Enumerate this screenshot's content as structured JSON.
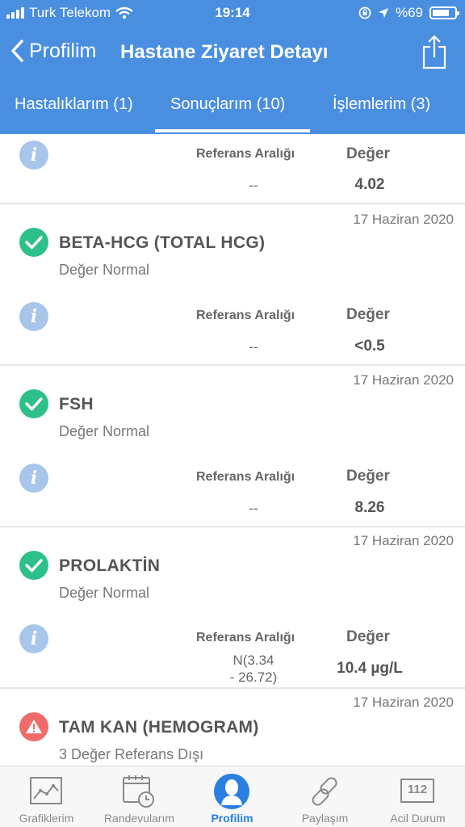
{
  "status_bar": {
    "carrier": "Turk Telekom",
    "time": "19:14",
    "battery": "%69"
  },
  "nav": {
    "back_label": "Profilim",
    "title": "Hastane Ziyaret Detayı"
  },
  "tabs": [
    {
      "label": "Hastalıklarım (1)"
    },
    {
      "label": "Sonuçlarım (10)",
      "active": true
    },
    {
      "label": "İşlemlerim (3)"
    }
  ],
  "info_glyph": "i",
  "columns": {
    "reference": "Referans Aralığı",
    "value": "Değer"
  },
  "partial_top": {
    "reference": "--",
    "value": "4.02"
  },
  "results": [
    {
      "date": "17 Haziran 2020",
      "name": "BETA-HCG (TOTAL HCG)",
      "status": "Değer Normal",
      "reference_line1": "--",
      "reference_line2": "",
      "value": "<0.5",
      "state": "normal"
    },
    {
      "date": "17 Haziran 2020",
      "name": "FSH",
      "status": "Değer Normal",
      "reference_line1": "--",
      "reference_line2": "",
      "value": "8.26",
      "state": "normal"
    },
    {
      "date": "17 Haziran 2020",
      "name": "PROLAKTİN",
      "status": "Değer Normal",
      "reference_line1": "N(3.34",
      "reference_line2": "- 26.72)",
      "value": "10.4 µg/L",
      "state": "normal"
    },
    {
      "date": "17 Haziran 2020",
      "name": "TAM KAN (HEMOGRAM)",
      "status": "3 Değer Referans Dışı",
      "state": "warning"
    }
  ],
  "tabbar": {
    "items": [
      {
        "label": "Grafiklerim",
        "icon": "chart-icon"
      },
      {
        "label": "Randevularım",
        "icon": "calendar-icon"
      },
      {
        "label": "Profilim",
        "icon": "profile-icon",
        "active": true
      },
      {
        "label": "Paylaşım",
        "icon": "link-icon"
      },
      {
        "label": "Acil Durum",
        "icon": "emergency-112-icon",
        "badge": "112"
      }
    ]
  },
  "colors": {
    "header": "#4a8ee0",
    "normal": "#2ec08a",
    "warning": "#ef6b6b",
    "info": "#a8c6ea",
    "active_tab": "#2a7fe0"
  }
}
